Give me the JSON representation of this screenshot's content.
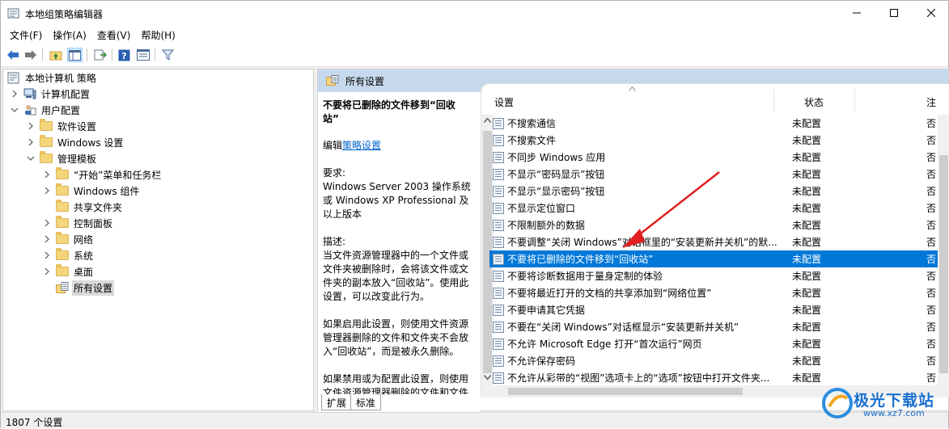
{
  "window": {
    "title": "本地组策略编辑器"
  },
  "menu": [
    "文件(F)",
    "操作(A)",
    "查看(V)",
    "帮助(H)"
  ],
  "tree": [
    {
      "label": "本地计算机 策略",
      "indent": 0,
      "chev": "",
      "icon": "policy"
    },
    {
      "label": "计算机配置",
      "indent": 1,
      "chev": "right",
      "icon": "computer"
    },
    {
      "label": "用户配置",
      "indent": 1,
      "chev": "down",
      "icon": "user"
    },
    {
      "label": "软件设置",
      "indent": 2,
      "chev": "right",
      "icon": "folder"
    },
    {
      "label": "Windows 设置",
      "indent": 2,
      "chev": "right",
      "icon": "folder"
    },
    {
      "label": "管理模板",
      "indent": 2,
      "chev": "down",
      "icon": "folder"
    },
    {
      "label": "“开始”菜单和任务栏",
      "indent": 3,
      "chev": "right",
      "icon": "folder"
    },
    {
      "label": "Windows 组件",
      "indent": 3,
      "chev": "right",
      "icon": "folder"
    },
    {
      "label": "共享文件夹",
      "indent": 3,
      "chev": "",
      "icon": "folder"
    },
    {
      "label": "控制面板",
      "indent": 3,
      "chev": "right",
      "icon": "folder"
    },
    {
      "label": "网络",
      "indent": 3,
      "chev": "right",
      "icon": "folder"
    },
    {
      "label": "系统",
      "indent": 3,
      "chev": "right",
      "icon": "folder"
    },
    {
      "label": "桌面",
      "indent": 3,
      "chev": "right",
      "icon": "folder"
    },
    {
      "label": "所有设置",
      "indent": 3,
      "chev": "",
      "icon": "allsettings",
      "selected": true
    }
  ],
  "right_header": "所有设置",
  "description": {
    "title": "不要将已删除的文件移到“回收站”",
    "edit_prefix": "编辑",
    "edit_link": "策略设置",
    "req_label": "要求:",
    "req_text": "Windows Server 2003 操作系统或 Windows XP Professional 及以上版本",
    "desc_label": "描述:",
    "desc_text": "当文件资源管理器中的一个文件或文件夹被删除时，会将该文件或文件夹的副本放入“回收站”。使用此设置，可以改变此行为。",
    "desc_text2": "如果启用此设置，则使用文件资源管理器删除的文件和文件夹不会放入“回收站”，而是被永久删除。",
    "desc_text3": "如果禁用或为配置此设置，则使用文件资源管理器删除的文件和文件夹会被放入“回收站”。"
  },
  "tabs": [
    "扩展",
    "标准"
  ],
  "columns": {
    "setting": "设置",
    "state": "状态",
    "comment": "注"
  },
  "rows": [
    {
      "name": "不搜索通信",
      "state": "未配置",
      "comment": "否"
    },
    {
      "name": "不搜索文件",
      "state": "未配置",
      "comment": "否"
    },
    {
      "name": "不同步 Windows 应用",
      "state": "未配置",
      "comment": "否"
    },
    {
      "name": "不显示“密码显示”按钮",
      "state": "未配置",
      "comment": "否"
    },
    {
      "name": "不显示“显示密码”按钮",
      "state": "未配置",
      "comment": "否"
    },
    {
      "name": "不显示定位窗口",
      "state": "未配置",
      "comment": "否"
    },
    {
      "name": "不限制额外的数据",
      "state": "未配置",
      "comment": "否"
    },
    {
      "name": "不要调整“关闭 Windows”对话框里的“安装更新并关机”的默...",
      "state": "未配置",
      "comment": "否"
    },
    {
      "name": "不要将已删除的文件移到“回收站”",
      "state": "未配置",
      "comment": "否",
      "selected": true
    },
    {
      "name": "不要将诊断数据用于量身定制的体验",
      "state": "未配置",
      "comment": "否"
    },
    {
      "name": "不要将最近打开的文档的共享添加到“网络位置”",
      "state": "未配置",
      "comment": "否"
    },
    {
      "name": "不要申请其它凭据",
      "state": "未配置",
      "comment": "否"
    },
    {
      "name": "不要在“关闭 Windows”对话框显示“安装更新并关机”",
      "state": "未配置",
      "comment": "否"
    },
    {
      "name": "不允许 Microsoft Edge 打开“首次运行”网页",
      "state": "未配置",
      "comment": "否"
    },
    {
      "name": "不允许保存密码",
      "state": "未配置",
      "comment": "否"
    },
    {
      "name": "不允许从彩带的“视图”选项卡上的“选项”按钮中打开文件夹...",
      "state": "未配置",
      "comment": "否"
    }
  ],
  "status": "1807 个设置",
  "watermark": {
    "name": "极光下载站",
    "url": "www.xz7.com"
  },
  "colors": {
    "selection": "#0078d7",
    "header": "#c6d9ec",
    "arrow": "#e02020"
  }
}
